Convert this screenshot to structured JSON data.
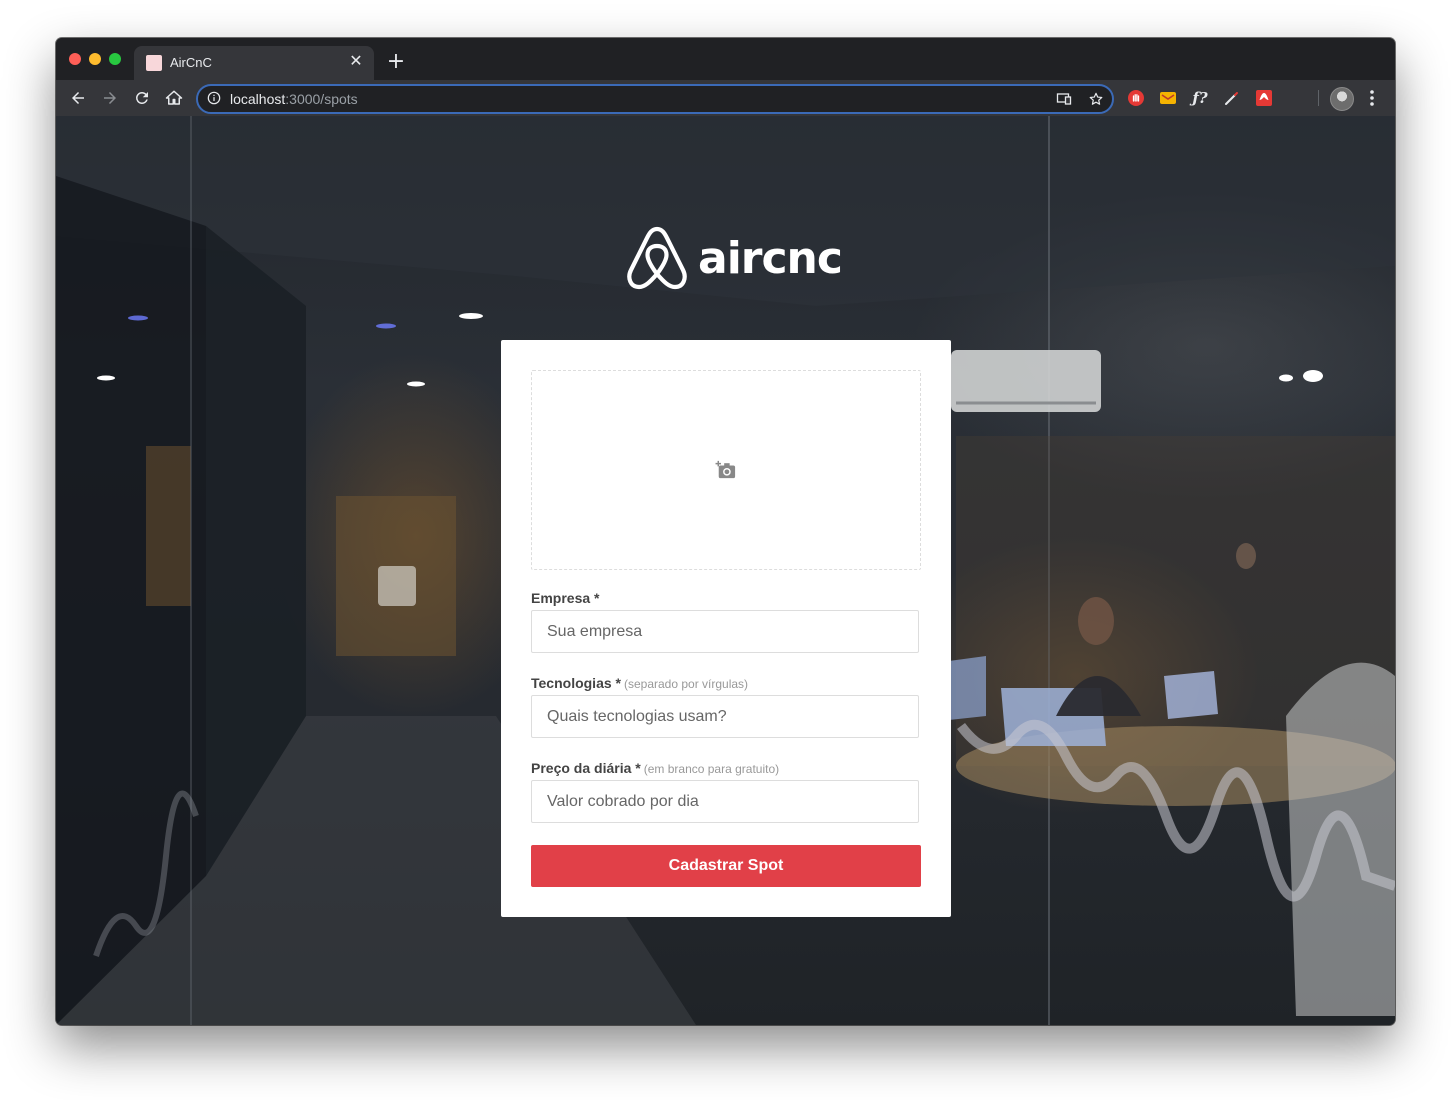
{
  "browser": {
    "tab_title": "AirCnC",
    "tab_close_glyph": "✕",
    "new_tab_glyph": "+",
    "url_host": "localhost",
    "url_path": ":3000/spots"
  },
  "logo": {
    "text": "aircnc",
    "mark": "airbnb-belo-icon"
  },
  "form": {
    "thumbnail_icon": "add-photo-icon",
    "company": {
      "label": "Empresa *",
      "placeholder": "Sua empresa"
    },
    "techs": {
      "label": "Tecnologias *",
      "hint": "(separado por vírgulas)",
      "placeholder": "Quais tecnologias usam?"
    },
    "price": {
      "label": "Preço da diária *",
      "hint": "(em branco para gratuito)",
      "placeholder": "Valor cobrado por dia"
    },
    "submit_label": "Cadastrar Spot"
  },
  "colors": {
    "accent": "#e14048",
    "card_bg": "#ffffff",
    "omnibox_focus": "#3b6ab7"
  }
}
